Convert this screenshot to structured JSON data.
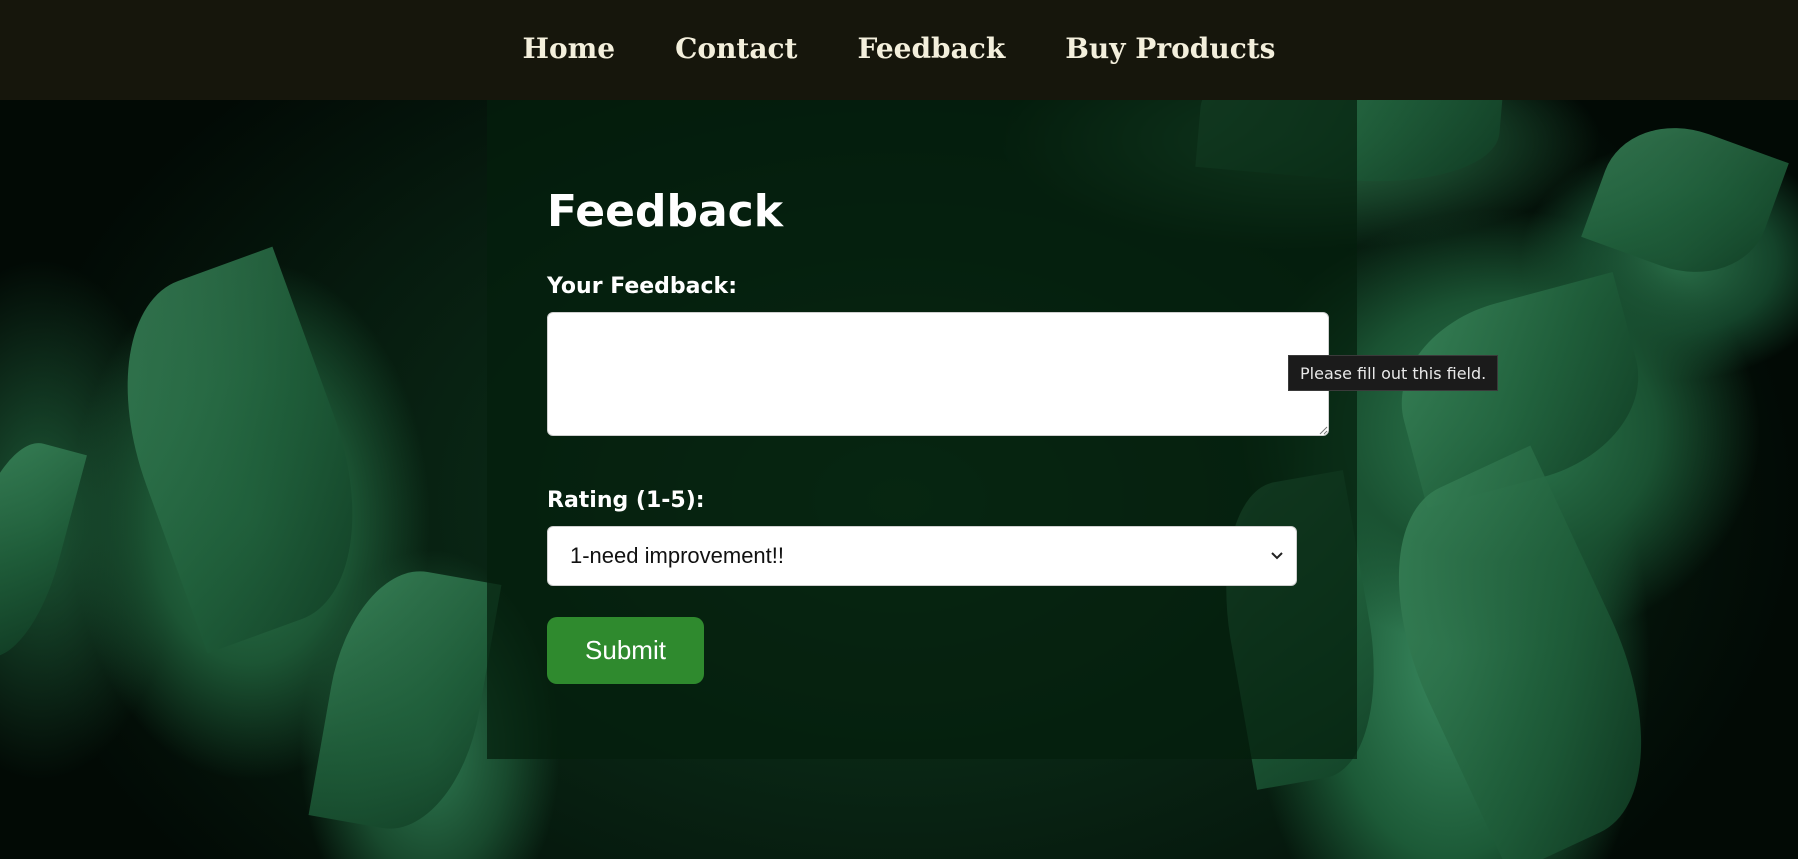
{
  "nav": {
    "items": [
      {
        "label": "Home"
      },
      {
        "label": "Contact"
      },
      {
        "label": "Feedback"
      },
      {
        "label": "Buy Products"
      }
    ]
  },
  "form": {
    "title": "Feedback",
    "feedback_label": "Your Feedback:",
    "feedback_value": "",
    "rating_label": "Rating (1-5):",
    "rating_selected": "1-need improvement!!",
    "submit_label": "Submit",
    "validation_tooltip": "Please fill out this field."
  },
  "colors": {
    "nav_background": "#16160c",
    "nav_text": "#f3efdc",
    "submit_button": "#2f8a2e",
    "panel_overlay": "#041e0c"
  }
}
